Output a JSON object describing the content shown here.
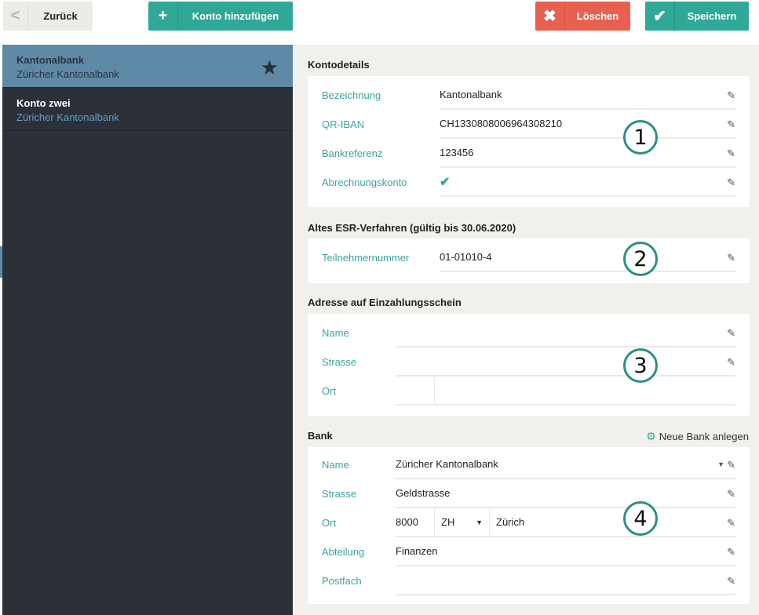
{
  "toolbar": {
    "back_icon": "<",
    "back_label": "Zurück",
    "add_icon": "+",
    "add_label": "Konto hinzufügen",
    "delete_icon": "✖",
    "delete_label": "Löschen",
    "save_icon": "✔",
    "save_label": "Speichern",
    "colors": {
      "teal": "#2fa898",
      "red": "#e8604f"
    }
  },
  "sidebar": {
    "accounts": [
      {
        "name": "Kantonalbank",
        "bank": "Züricher Kantonalbank",
        "favorite_icon": "★"
      },
      {
        "name": "Konto zwei",
        "bank": "Züricher Kantonalbank"
      }
    ]
  },
  "sections": {
    "kontodetails": {
      "title": "Kontodetails",
      "fields": [
        {
          "label": "Bezeichnung",
          "value": "Kantonalbank"
        },
        {
          "label": "QR-IBAN",
          "value": "CH1330808006964308210"
        },
        {
          "label": "Bankreferenz",
          "value": "123456"
        },
        {
          "label": "Abrechnungskonto",
          "value": "✔"
        }
      ],
      "marker": "1"
    },
    "esr": {
      "title": "Altes ESR-Verfahren (gültig bis 30.06.2020)",
      "fields": [
        {
          "label": "Teilnehmernummer",
          "value": "01-01010-4"
        }
      ],
      "marker": "2"
    },
    "adresse": {
      "title": "Adresse auf Einzahlungsschein",
      "fields": [
        {
          "label": "Name",
          "value": ""
        },
        {
          "label": "Strasse",
          "value": ""
        },
        {
          "label": "Ort",
          "value": ""
        }
      ],
      "marker": "3"
    },
    "bank": {
      "title": "Bank",
      "new_bank_label": "Neue Bank anlegen",
      "fields": [
        {
          "label": "Name",
          "value": "Züricher Kantonalbank"
        },
        {
          "label": "Strasse",
          "value": "Geldstrasse"
        },
        {
          "label": "Ort",
          "plz": "8000",
          "canton": "ZH",
          "city": "Zürich"
        },
        {
          "label": "Abteilung",
          "value": "Finanzen"
        },
        {
          "label": "Postfach",
          "value": ""
        }
      ],
      "marker": "4"
    }
  },
  "icons": {
    "edit": "pencil-icon",
    "dropdown": "caret-down-icon",
    "gear": "gear-icon",
    "star": "star-icon"
  }
}
